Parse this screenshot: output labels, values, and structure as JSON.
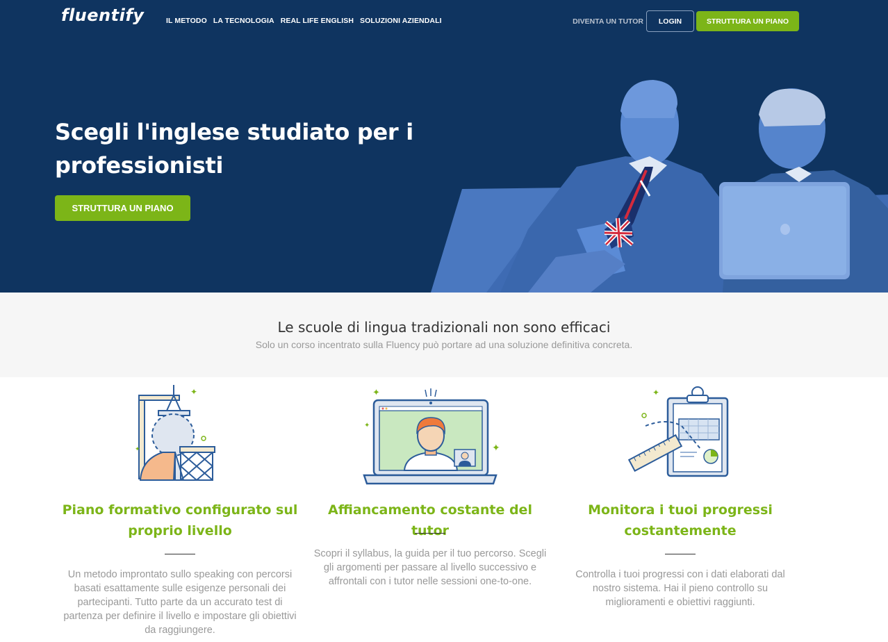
{
  "nav": {
    "logo": "fluentify",
    "links": [
      "IL METODO",
      "LA TECNOLOGIA",
      "REAL LIFE ENGLISH",
      "SOLUZIONI AZIENDALI"
    ],
    "tutor": "DIVENTA UN TUTOR",
    "login": "LOGIN",
    "cta": "STRUTTURA UN PIANO"
  },
  "hero": {
    "title": "Scegli l'inglese studiato per i professionisti",
    "cta": "STRUTTURA UN PIANO"
  },
  "intro": {
    "title": "Le scuole di lingua tradizionali non sono efficaci",
    "subtitle": "Solo un corso incentrato sulla Fluency può portare ad una soluzione definitiva concreta."
  },
  "features": [
    {
      "title": "Piano formativo configurato sul proprio livello",
      "text": "Un metodo improntato sullo speaking con percorsi basati esattamente sulle esigenze personali dei partecipanti. Tutto parte da un accurato test di partenza per definire il livello e impostare gli obiettivi da raggiungere."
    },
    {
      "title": "Affiancamento costante del tutor",
      "text": "Scopri il syllabus, la guida per il tuo percorso. Scegli gli argomenti per passare al livello successivo e affrontali con i tutor nelle sessioni one-to-one."
    },
    {
      "title": "Monitora i tuoi progressi costantemente",
      "text": "Controlla i tuoi progressi con i dati elaborati dal nostro sistema. Hai il pieno controllo su miglioramenti e obiettivi raggiunti."
    }
  ],
  "colors": {
    "navy": "#0f3460",
    "green": "#7cb518",
    "blue_tint": "#4d7fc8"
  }
}
